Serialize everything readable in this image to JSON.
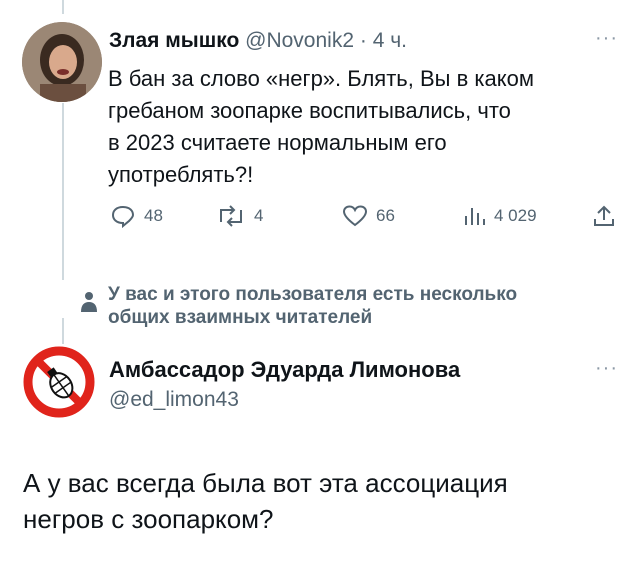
{
  "tweet1": {
    "author_name": "Злая мышко",
    "author_handle": "@Novonik2",
    "separator": "·",
    "time": "4 ч.",
    "more": "···",
    "text_lines": [
      "В бан за слово «негр». Блять, Вы в каком",
      "гребаном зоопарке воспитывались, что",
      "в 2023 считаете нормальным его",
      "употреблять?!"
    ],
    "actions": {
      "replies": "48",
      "reposts": "4",
      "likes": "66",
      "views": "4 029"
    }
  },
  "mutual_followers": {
    "lines": [
      "У вас и этого пользователя есть несколько",
      "общих взаимных читателей"
    ]
  },
  "tweet2": {
    "author_name": "Амбассадор Эдуарда Лимонова",
    "author_handle": "@ed_limon43",
    "more": "···",
    "text_lines": [
      "А у вас всегда была вот эта ассоциация",
      "негров с зоопарком?"
    ]
  },
  "colors": {
    "text": "#0f1419",
    "secondary": "#536471",
    "thread_line": "#cfd9de",
    "avatar2_ring": "#e0241b"
  }
}
